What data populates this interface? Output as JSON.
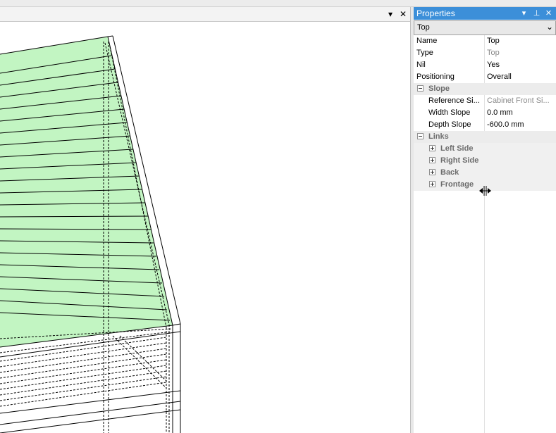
{
  "viewport": {
    "menu_icon": "dropdown-triangle-icon",
    "close_icon": "close-icon",
    "fill_color": "#c2f5c2",
    "outline_color": "#000000"
  },
  "properties": {
    "title": "Properties",
    "title_bg": "#3c8fd9",
    "selected_object": "Top",
    "rows": [
      {
        "label": "Name",
        "value": "Top"
      },
      {
        "label": "Type",
        "value": "Top"
      },
      {
        "label": "Nil",
        "value": "Yes"
      },
      {
        "label": "Positioning",
        "value": "Overall"
      }
    ],
    "slope": {
      "label": "Slope",
      "rows": [
        {
          "label": "Reference Si...",
          "value": "Cabinet Front Si..."
        },
        {
          "label": "Width Slope",
          "value": "0.0 mm"
        },
        {
          "label": "Depth Slope",
          "value": "-600.0 mm"
        }
      ]
    },
    "links": {
      "label": "Links",
      "items": [
        "Left Side",
        "Right Side",
        "Back",
        "Frontage"
      ]
    }
  }
}
